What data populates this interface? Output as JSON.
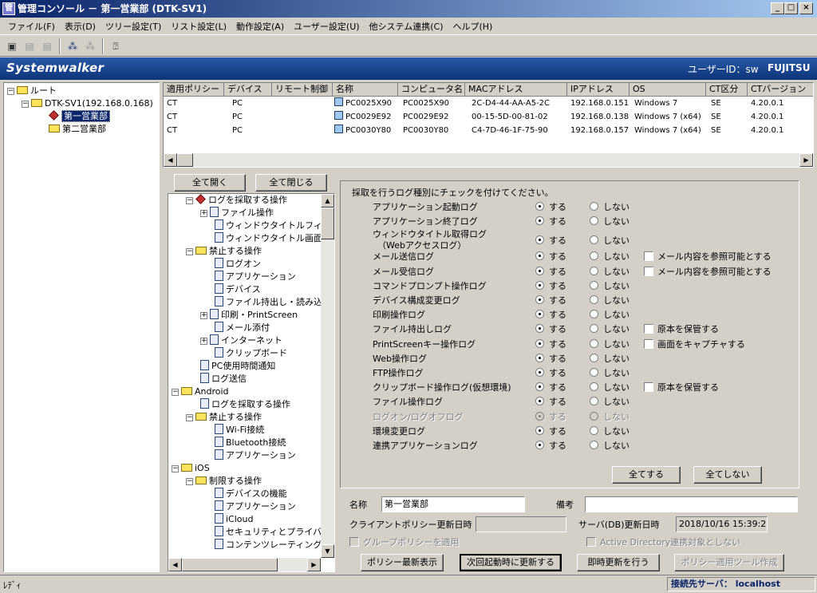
{
  "window": {
    "title": "管理コンソール － 第一営業部 (DTK-SV1)",
    "app_icon": "console-icon"
  },
  "menu": [
    "ファイル(F)",
    "表示(D)",
    "ツリー設定(T)",
    "リスト設定(L)",
    "動作設定(A)",
    "ユーザー設定(U)",
    "他システム連携(C)",
    "ヘルプ(H)"
  ],
  "brand": {
    "logo": "Systemwalker",
    "user_id": "ユーザーID：sw",
    "vendor": "FUJITSU"
  },
  "tree": {
    "root": "ルート",
    "server": "DTK-SV1(192.168.0.168)",
    "dept1": "第一営業部",
    "dept2": "第二営業部"
  },
  "table": {
    "headers": [
      "適用ポリシー",
      "デバイス",
      "リモート制御",
      "名称",
      "コンピュータ名",
      "MACアドレス",
      "IPアドレス",
      "OS",
      "CT区分",
      "CTバージョン"
    ],
    "rows": [
      [
        "CT",
        "PC",
        "",
        "PC0025X90",
        "PC0025X90",
        "2C-D4-44-AA-A5-2C",
        "192.168.0.151",
        "Windows 7",
        "SE",
        "4.20.0.1"
      ],
      [
        "CT",
        "PC",
        "",
        "PC0029E92",
        "PC0029E92",
        "00-15-5D-00-81-02",
        "192.168.0.138",
        "Windows 7 (x64)",
        "SE",
        "4.20.0.1"
      ],
      [
        "CT",
        "PC",
        "",
        "PC0030Y80",
        "PC0030Y80",
        "C4-7D-46-1F-75-90",
        "192.168.0.157",
        "Windows 7 (x64)",
        "SE",
        "4.20.0.1"
      ]
    ]
  },
  "policy_tree": {
    "expand_all": "全て開く",
    "collapse_all": "全て閉じる",
    "items": {
      "log_ops": "ログを採取する操作",
      "file_ops": "ファイル操作",
      "wintitle_filter": "ウィンドウタイトルフィル",
      "wintitle_screen": "ウィンドウタイトル画面=",
      "prohibit_ops": "禁止する操作",
      "logon": "ログオン",
      "application": "アプリケーション",
      "device": "デバイス",
      "file_export": "ファイル持出し・読み込",
      "print": "印刷・PrintScreen",
      "mail_attach": "メール添付",
      "internet": "インターネット",
      "clipboard": "クリップボード",
      "pc_usage": "PC使用時間通知",
      "log_send": "ログ送信",
      "android": "Android",
      "a_log_ops": "ログを採取する操作",
      "a_prohibit": "禁止する操作",
      "wifi": "Wi-Fi接続",
      "bluetooth": "Bluetooth接続",
      "a_app": "アプリケーション",
      "ios": "iOS",
      "i_restrict": "制限する操作",
      "i_device_func": "デバイスの機能",
      "i_app": "アプリケーション",
      "icloud": "iCloud",
      "security_privacy": "セキュリティとプライバシ",
      "content_rating": "コンテンツレーティング"
    }
  },
  "log_settings": {
    "instruction": "採取を行うログ種別にチェックを付けてください。",
    "on_label": "する",
    "off_label": "しない",
    "rows": [
      {
        "name": "アプリケーション起動ログ",
        "on": true,
        "disabled": false,
        "extra": ""
      },
      {
        "name": "アプリケーション終了ログ",
        "on": true,
        "disabled": false,
        "extra": ""
      },
      {
        "name": "ウィンドウタイトル取得ログ",
        "name2": "（Webアクセスログ）",
        "on": true,
        "disabled": false,
        "extra": ""
      },
      {
        "name": "メール送信ログ",
        "on": true,
        "disabled": false,
        "extra": "メール内容を参照可能とする"
      },
      {
        "name": "メール受信ログ",
        "on": true,
        "disabled": false,
        "extra": "メール内容を参照可能とする"
      },
      {
        "name": "コマンドプロンプト操作ログ",
        "on": true,
        "disabled": false,
        "extra": ""
      },
      {
        "name": "デバイス構成変更ログ",
        "on": true,
        "disabled": false,
        "extra": ""
      },
      {
        "name": "印刷操作ログ",
        "on": true,
        "disabled": false,
        "extra": ""
      },
      {
        "name": "ファイル持出しログ",
        "on": true,
        "disabled": false,
        "extra": "原本を保管する"
      },
      {
        "name": "PrintScreenキー操作ログ",
        "on": true,
        "disabled": false,
        "extra": "画面をキャプチャする"
      },
      {
        "name": "Web操作ログ",
        "on": true,
        "disabled": false,
        "extra": ""
      },
      {
        "name": "FTP操作ログ",
        "on": true,
        "disabled": false,
        "extra": ""
      },
      {
        "name": "クリップボード操作ログ(仮想環境)",
        "on": true,
        "disabled": false,
        "extra": "原本を保管する"
      },
      {
        "name": "ファイル操作ログ",
        "on": true,
        "disabled": false,
        "extra": ""
      },
      {
        "name": "ログオン/ログオフログ",
        "on": true,
        "disabled": true,
        "extra": ""
      },
      {
        "name": "環境変更ログ",
        "on": true,
        "disabled": false,
        "extra": ""
      },
      {
        "name": "連携アプリケーションログ",
        "on": true,
        "disabled": false,
        "extra": ""
      }
    ],
    "all_on": "全てする",
    "all_off": "全てしない"
  },
  "info": {
    "name_label": "名称",
    "name_value": "第一営業部",
    "note_label": "備考",
    "note_value": "",
    "client_update_label": "クライアントポリシー更新日時",
    "client_update_value": "",
    "server_update_label": "サーバ(DB)更新日時",
    "server_update_value": "2018/10/16 15:39:20",
    "group_policy": "グループポリシーを適用",
    "ad_exclude": "Active Directory連携対象としない"
  },
  "actions": {
    "latest": "ポリシー最新表示",
    "next_boot": "次回起動時に更新する",
    "immediate": "即時更新を行う",
    "tool": "ポリシー適用ツール作成"
  },
  "status": {
    "left": "ﾚﾃﾞｨ",
    "server": "接続先サーバ： localhost"
  },
  "colors": {
    "title_start": "#0a246a",
    "title_end": "#a6caf0",
    "brand": "#1a4a98",
    "selection": "#0a246a"
  }
}
